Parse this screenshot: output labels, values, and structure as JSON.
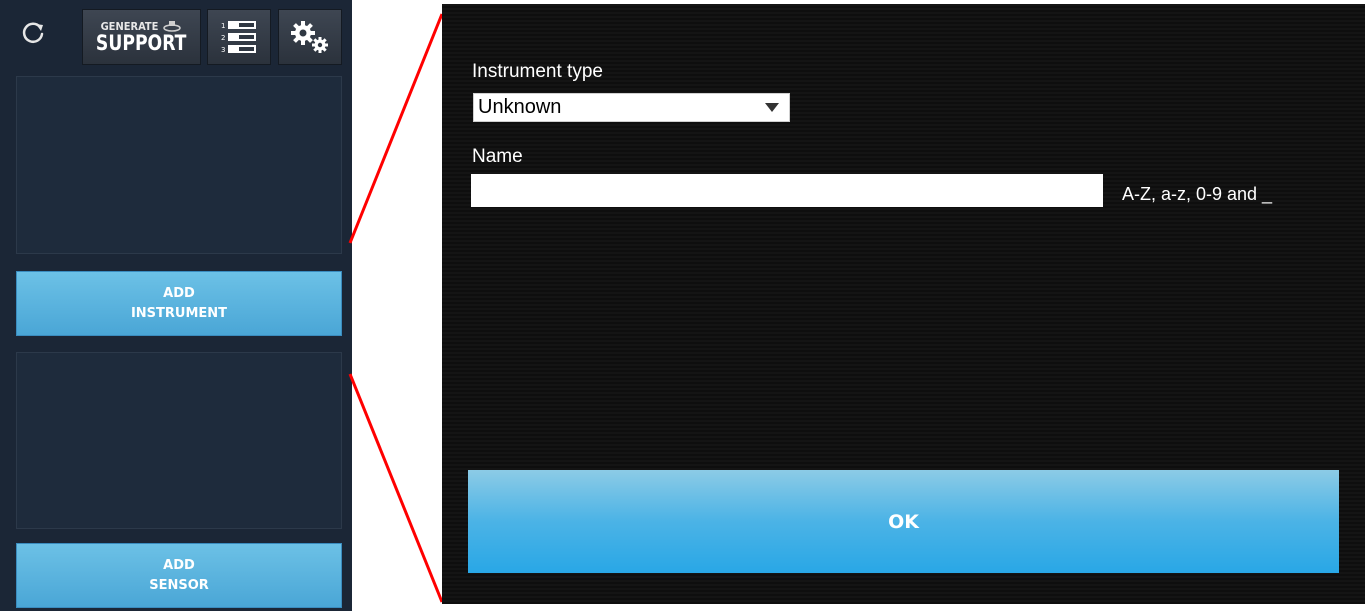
{
  "toolbar": {
    "refresh_icon": "refresh-icon",
    "generate_support_line1": "GENERATE",
    "generate_support_line2": "SUPPORT",
    "list_icon": "numbered-list-icon",
    "settings_icon": "gears-icon"
  },
  "sidebar": {
    "add_instrument_line1": "ADD",
    "add_instrument_line2": "INSTRUMENT",
    "add_sensor_line1": "ADD",
    "add_sensor_line2": "SENSOR"
  },
  "dialog": {
    "instrument_type_label": "Instrument type",
    "instrument_type_value": "Unknown",
    "name_label": "Name",
    "name_value": "",
    "name_hint": "A-Z, a-z, 0-9 and _",
    "ok_label": "OK"
  },
  "colors": {
    "sidebar_bg": "#1b2636",
    "button_blue": "#4aa6d6",
    "connector": "#ff0000",
    "dialog_bg": "#111111"
  }
}
